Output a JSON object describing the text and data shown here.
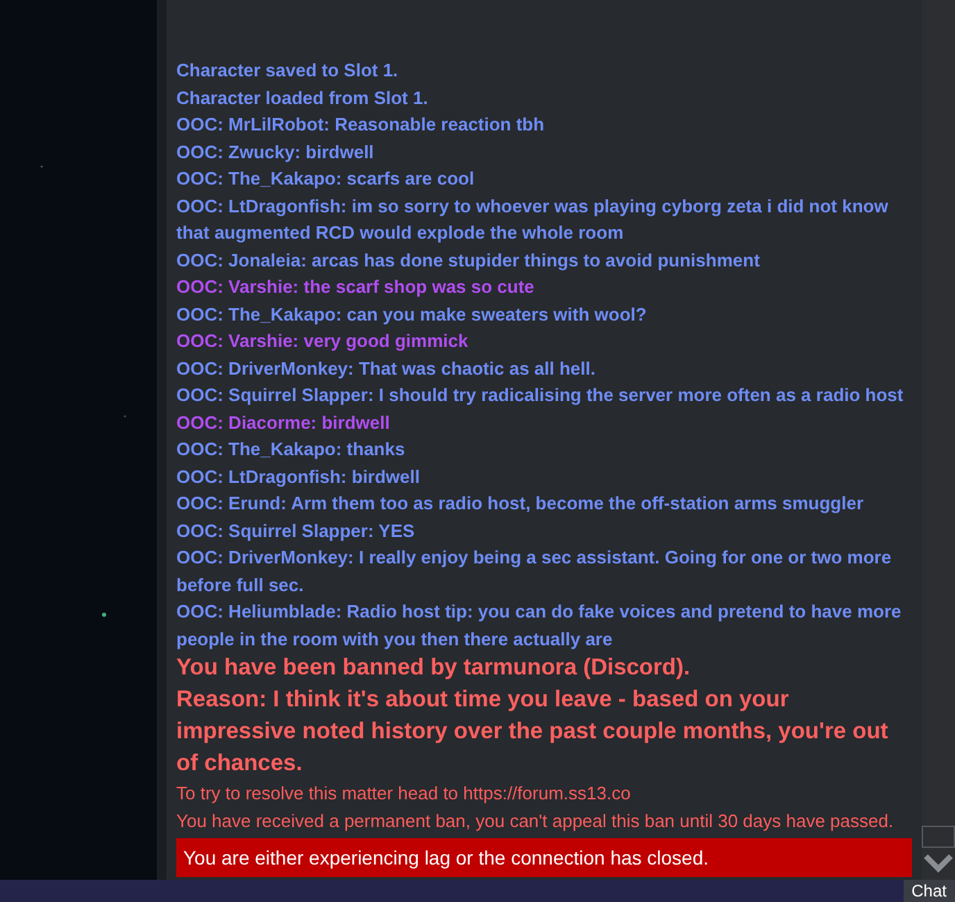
{
  "messages": [
    {
      "kind": "system",
      "text": "Character saved to Slot 1."
    },
    {
      "kind": "system",
      "text": "Character loaded from Slot 1."
    },
    {
      "kind": "ooc",
      "text": "OOC: MrLilRobot: Reasonable reaction tbh"
    },
    {
      "kind": "ooc",
      "text": "OOC: Zwucky: birdwell"
    },
    {
      "kind": "ooc",
      "text": "OOC: The_Kakapo: scarfs are cool"
    },
    {
      "kind": "ooc",
      "text": "OOC: LtDragonfish: im so sorry to whoever was playing cyborg zeta i did not know that augmented RCD would explode the whole room"
    },
    {
      "kind": "ooc",
      "text": "OOC: Jonaleia: arcas has done stupider things to avoid punishment"
    },
    {
      "kind": "donor",
      "text": "OOC: Varshie: the scarf shop was so cute"
    },
    {
      "kind": "ooc",
      "text": "OOC: The_Kakapo: can you make sweaters with wool?"
    },
    {
      "kind": "donor",
      "text": "OOC: Varshie: very good gimmick"
    },
    {
      "kind": "ooc",
      "text": "OOC: DriverMonkey: That was chaotic as all hell."
    },
    {
      "kind": "ooc",
      "text": "OOC: Squirrel Slapper: I should try radicalising the server more often as a radio host"
    },
    {
      "kind": "donor",
      "text": "OOC: Diacorme: birdwell"
    },
    {
      "kind": "ooc",
      "text": "OOC: The_Kakapo: thanks"
    },
    {
      "kind": "ooc",
      "text": "OOC: LtDragonfish: birdwell"
    },
    {
      "kind": "ooc",
      "text": "OOC: Erund: Arm them too as radio host, become the off-station arms smuggler"
    },
    {
      "kind": "ooc",
      "text": "OOC: Squirrel Slapper: YES"
    },
    {
      "kind": "ooc",
      "text": "OOC: DriverMonkey: I really enjoy being a sec assistant. Going for one or two more before full sec."
    },
    {
      "kind": "ooc",
      "text": "OOC: Heliumblade: Radio host tip: you can do fake voices and pretend to have more people in the room with you then there actually are"
    },
    {
      "kind": "ban",
      "text": "You have been banned by tarmunora (Discord)."
    },
    {
      "kind": "ban",
      "text": "Reason: I think it's about time you leave - based on your impressive noted history over the past couple months, you're out of chances."
    },
    {
      "kind": "notice",
      "text": "To try to resolve this matter head to https://forum.ss13.co"
    },
    {
      "kind": "notice",
      "text": "You have received a permanent ban, you can't appeal this ban until 30 days have passed."
    }
  ],
  "connection_warning": "You are either experiencing lag or the connection has closed.",
  "bottom_tab": "Chat"
}
